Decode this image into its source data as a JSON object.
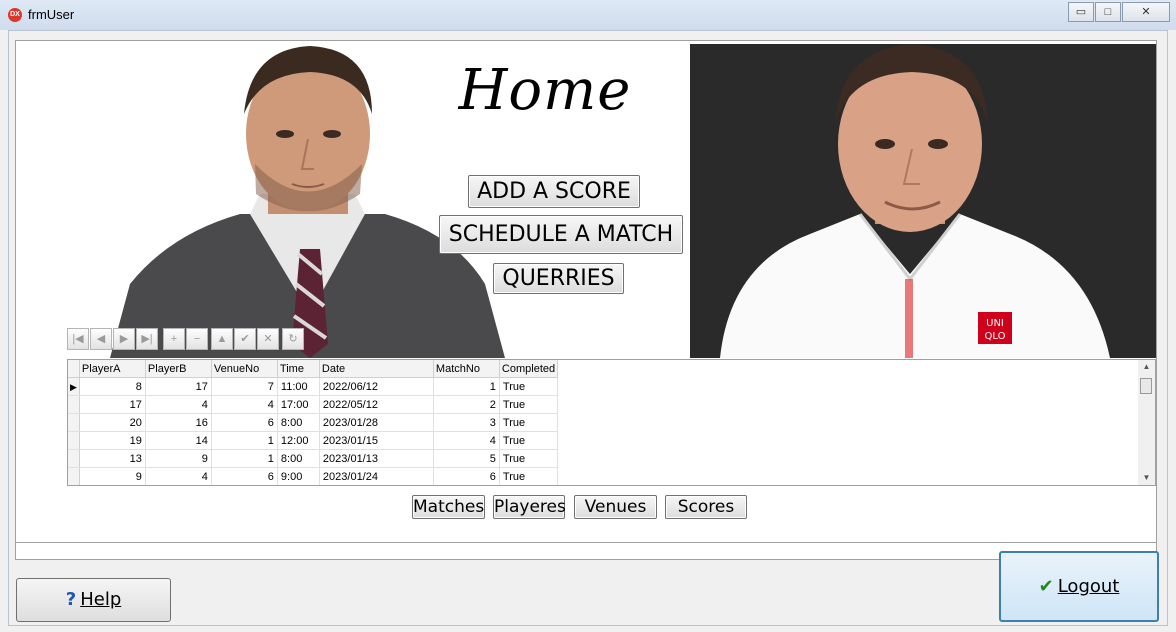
{
  "window": {
    "title": "frmUser",
    "icon_text": "DX",
    "controls": {
      "minimize": "▭",
      "maximize": "□",
      "close": "✕"
    }
  },
  "home": {
    "title": "Home"
  },
  "menu": {
    "add_score": "ADD A SCORE",
    "schedule_match": "SCHEDULE A MATCH",
    "querries": "QUERRIES"
  },
  "navigator": {
    "buttons": [
      {
        "name": "first-record",
        "glyph": "|◀"
      },
      {
        "name": "prior-record",
        "glyph": "◀"
      },
      {
        "name": "next-record",
        "glyph": "▶"
      },
      {
        "name": "last-record",
        "glyph": "▶|"
      },
      {
        "name": "insert-record",
        "glyph": "+"
      },
      {
        "name": "delete-record",
        "glyph": "−"
      },
      {
        "name": "edit-record",
        "glyph": "▲"
      },
      {
        "name": "post-record",
        "glyph": "✔"
      },
      {
        "name": "cancel-record",
        "glyph": "✕"
      },
      {
        "name": "refresh-record",
        "glyph": "↻"
      }
    ]
  },
  "grid": {
    "columns": [
      "PlayerA",
      "PlayerB",
      "VenueNo",
      "Time",
      "Date",
      "MatchNo",
      "Completed"
    ],
    "rows": [
      [
        "8",
        "17",
        "7",
        "11:00",
        "2022/06/12",
        "1",
        "True"
      ],
      [
        "17",
        "4",
        "4",
        "17:00",
        "2022/05/12",
        "2",
        "True"
      ],
      [
        "20",
        "16",
        "6",
        "8:00",
        "2023/01/28",
        "3",
        "True"
      ],
      [
        "19",
        "14",
        "1",
        "12:00",
        "2023/01/15",
        "4",
        "True"
      ],
      [
        "13",
        "9",
        "1",
        "8:00",
        "2023/01/13",
        "5",
        "True"
      ],
      [
        "9",
        "4",
        "6",
        "9:00",
        "2023/01/24",
        "6",
        "True"
      ]
    ]
  },
  "tabs": {
    "matches": "Matches",
    "players": "Playeres",
    "venues": "Venues",
    "scores": "Scores"
  },
  "footer": {
    "help_label": "Help",
    "help_icon": "?",
    "logout_label": "Logout",
    "logout_icon": "✔"
  },
  "photos": {
    "left_shirt": "#e8e8e8",
    "right_shirt": "#ffffff",
    "right_bg": "#262626",
    "logo_text_top": "UNI",
    "logo_text_bottom": "QLO"
  }
}
